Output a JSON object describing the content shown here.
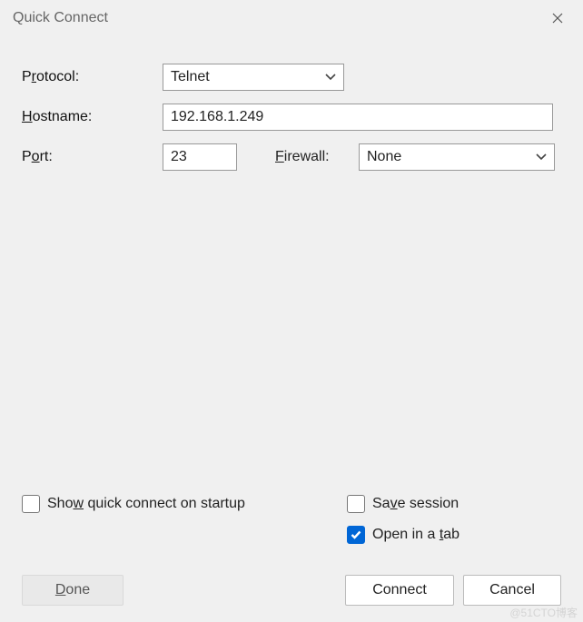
{
  "title": "Quick Connect",
  "labels": {
    "protocol_pre": "P",
    "protocol_u": "r",
    "protocol_post": "otocol:",
    "hostname_u": "H",
    "hostname_post": "ostname:",
    "port_pre": "P",
    "port_u": "o",
    "port_post": "rt:",
    "firewall_u": "F",
    "firewall_post": "irewall:"
  },
  "values": {
    "protocol": "Telnet",
    "hostname": "192.168.1.249",
    "port": "23",
    "firewall": "None"
  },
  "checkboxes": {
    "show_startup_pre": "Sho",
    "show_startup_u": "w",
    "show_startup_post": " quick connect on startup",
    "save_session_pre": "Sa",
    "save_session_u": "v",
    "save_session_post": "e session",
    "open_tab_pre": "Open in a ",
    "open_tab_u": "t",
    "open_tab_post": "ab"
  },
  "buttons": {
    "done_u": "D",
    "done_post": "one",
    "connect": "Connect",
    "cancel": "Cancel"
  },
  "watermark": "@51CTO博客"
}
